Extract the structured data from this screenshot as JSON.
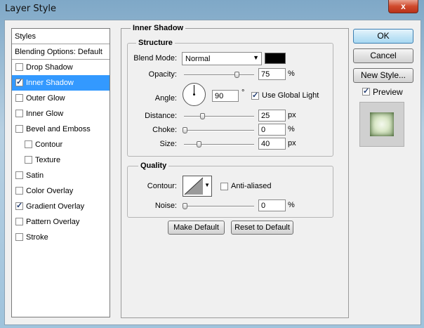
{
  "window": {
    "title": "Layer Style",
    "close_glyph": "x"
  },
  "sidebar": {
    "header": "Styles",
    "blending": "Blending Options: Default",
    "items": [
      {
        "label": "Drop Shadow",
        "checked": false,
        "selected": false
      },
      {
        "label": "Inner Shadow",
        "checked": true,
        "selected": true
      },
      {
        "label": "Outer Glow",
        "checked": false,
        "selected": false
      },
      {
        "label": "Inner Glow",
        "checked": false,
        "selected": false
      },
      {
        "label": "Bevel and Emboss",
        "checked": false,
        "selected": false
      },
      {
        "label": "Contour",
        "checked": false,
        "selected": false,
        "indent": true
      },
      {
        "label": "Texture",
        "checked": false,
        "selected": false,
        "indent": true
      },
      {
        "label": "Satin",
        "checked": false,
        "selected": false
      },
      {
        "label": "Color Overlay",
        "checked": false,
        "selected": false
      },
      {
        "label": "Gradient Overlay",
        "checked": true,
        "selected": false
      },
      {
        "label": "Pattern Overlay",
        "checked": false,
        "selected": false
      },
      {
        "label": "Stroke",
        "checked": false,
        "selected": false
      }
    ]
  },
  "inner_shadow": {
    "title": "Inner Shadow",
    "structure": {
      "title": "Structure",
      "blend_mode_label": "Blend Mode:",
      "blend_mode_value": "Normal",
      "shadow_color": "#000000",
      "opacity_label": "Opacity:",
      "opacity_value": "75",
      "opacity_unit": "%",
      "angle_label": "Angle:",
      "angle_value": "90",
      "angle_unit": "°",
      "use_global_light_label": "Use Global Light",
      "use_global_light": true,
      "distance_label": "Distance:",
      "distance_value": "25",
      "distance_unit": "px",
      "choke_label": "Choke:",
      "choke_value": "0",
      "choke_unit": "%",
      "size_label": "Size:",
      "size_value": "40",
      "size_unit": "px"
    },
    "quality": {
      "title": "Quality",
      "contour_label": "Contour:",
      "anti_aliased_label": "Anti-aliased",
      "anti_aliased": false,
      "noise_label": "Noise:",
      "noise_value": "0",
      "noise_unit": "%"
    },
    "make_default": "Make Default",
    "reset_default": "Reset to Default"
  },
  "actions": {
    "ok": "OK",
    "cancel": "Cancel",
    "new_style": "New Style...",
    "preview_label": "Preview",
    "preview": true
  },
  "colors": {
    "selection": "#3399ff",
    "accent_button": "#3c7fb1"
  }
}
